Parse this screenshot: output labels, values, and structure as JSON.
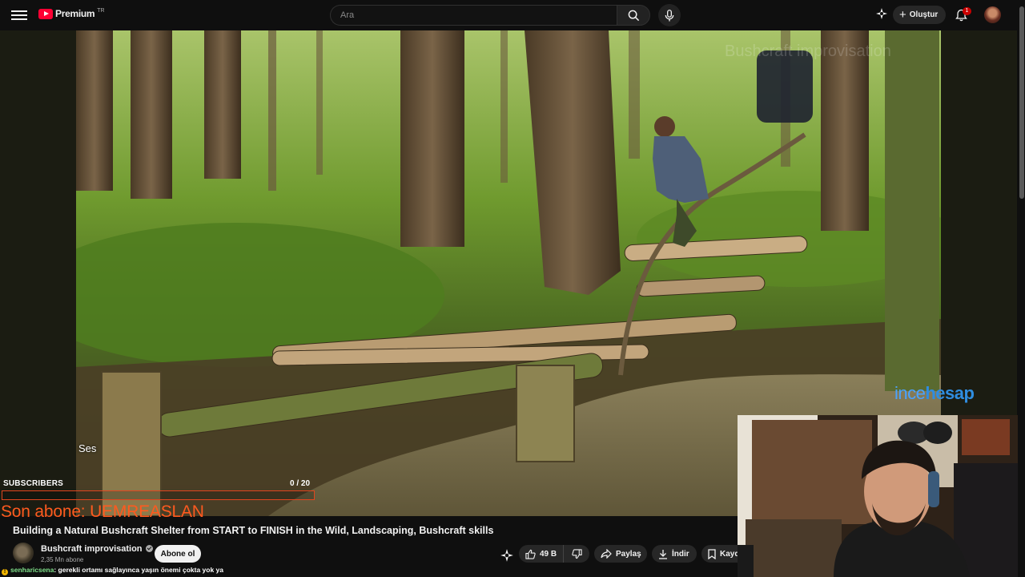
{
  "topbar": {
    "logo_text": "Premium",
    "logo_sup": "TR",
    "search_placeholder": "Ara",
    "create_label": "Oluştur",
    "notification_count": "1"
  },
  "video": {
    "watermark_top": "Bushcraft improvisation",
    "watermark_brand_light": "ince",
    "watermark_brand_bold": "hesap",
    "sound_label": "Ses"
  },
  "overlay": {
    "subscribers_title": "SUBSCRIBERS",
    "subscribers_count": "0  / 20",
    "subscribers_progress": 0.0,
    "last_subscriber": "Son abone: UEMREASLAN"
  },
  "info": {
    "title": "Building a Natural Bushcraft Shelter from START to FINISH in the Wild, Landscaping, Bushcraft skills",
    "channel_name": "Bushcraft improvisation",
    "channel_subs": "2,35 Mn abone",
    "subscribe_label": "Abone ol",
    "likes": "49 B",
    "share_label": "Paylaş",
    "download_label": "İndir",
    "save_label": "Kaydet"
  },
  "chat": {
    "user": "senharicsena",
    "message": ": gerekli ortamı sağlayınca yaşın önemi çokta yok ya"
  },
  "colors": {
    "accent_red": "#ff0033",
    "overlay_orange": "#ff5a1f",
    "watermark_blue": "#2f8de0"
  }
}
